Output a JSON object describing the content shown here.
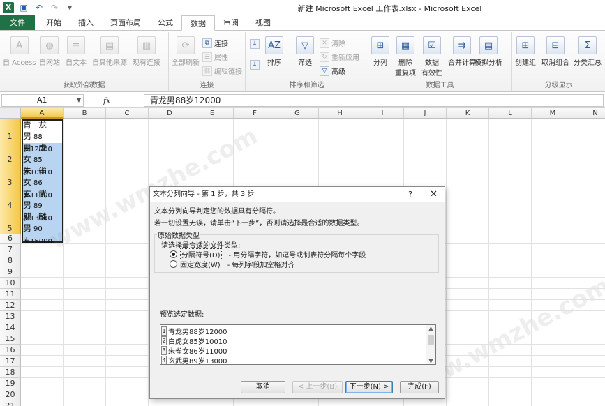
{
  "app": {
    "title": "新建 Microsoft Excel 工作表.xlsx - Microsoft Excel",
    "window_controls": [
      "?",
      "—",
      "❐",
      "✕"
    ]
  },
  "qat": [
    "save-icon",
    "undo-icon",
    "redo-icon",
    "customize-icon"
  ],
  "tabs": [
    {
      "label": "文件",
      "state": "file"
    },
    {
      "label": "开始"
    },
    {
      "label": "插入"
    },
    {
      "label": "页面布局"
    },
    {
      "label": "公式"
    },
    {
      "label": "数据",
      "state": "active"
    },
    {
      "label": "审阅"
    },
    {
      "label": "视图"
    }
  ],
  "ribbon": {
    "groups": {
      "external": {
        "label": "获取外部数据",
        "buttons": [
          "自 Access",
          "自网站",
          "自文本",
          "自其他来源",
          "现有连接"
        ]
      },
      "connections": {
        "label": "连接",
        "refresh": "全部刷新",
        "small": [
          "连接",
          "属性",
          "编辑链接"
        ]
      },
      "sort_filter": {
        "label": "排序和筛选",
        "sort": "排序",
        "filter": "筛选",
        "small": [
          "清除",
          "重新应用",
          "高级"
        ]
      },
      "data_tools": {
        "label": "数据工具",
        "buttons": [
          "分列",
          "删除",
          "数据",
          "合并计算",
          "模拟分析"
        ],
        "second_line": [
          "重复项",
          "有效性"
        ]
      },
      "outline": {
        "label": "分级显示",
        "buttons": [
          "创建组",
          "取消组合",
          "分类汇总"
        ]
      }
    }
  },
  "formula_bar": {
    "name_box": "A1",
    "fx": "fx",
    "content": "青龙男88岁12000"
  },
  "columns": [
    "A",
    "B",
    "C",
    "D",
    "E",
    "F",
    "G",
    "H",
    "I",
    "J",
    "K",
    "L",
    "M",
    "N"
  ],
  "rows": [
    "1",
    "2",
    "3",
    "4",
    "5",
    "6",
    "7",
    "8",
    "9",
    "10",
    "11",
    "12",
    "13",
    "14",
    "15",
    "16",
    "17",
    "18",
    "19",
    "20",
    "21"
  ],
  "cells": [
    {
      "big": "青 龙 男",
      "num": "88",
      "line2": "岁12000"
    },
    {
      "big": "白 虎 女",
      "num": "85",
      "line2": "岁10010"
    },
    {
      "big": "朱 雀 女",
      "num": "86",
      "line2": "岁11000"
    },
    {
      "big": "玄 武 男",
      "num": "89",
      "line2": "岁13000"
    },
    {
      "big": "麒 麟 男",
      "num": "90",
      "line2": "岁15000"
    }
  ],
  "dialog": {
    "title": "文本分列向导 - 第 1 步，共 3 步",
    "help": "?",
    "close": "✕",
    "intro1": "文本分列向导判定您的数据具有分隔符。",
    "intro2": "若一切设置无误，请单击“下一步”，否则请选择最合适的数据类型。",
    "group_label": "原始数据类型",
    "choose_label": "请选择最合适的文件类型:",
    "options": [
      {
        "label": "分隔符号(D)",
        "desc": "- 用分隔字符，如逗号或制表符分隔每个字段",
        "checked": true
      },
      {
        "label": "固定宽度(W)",
        "desc": "- 每列字段加空格对齐",
        "checked": false
      }
    ],
    "preview_label": "预览选定数据:",
    "preview_rows": [
      {
        "num": "1",
        "text": "青龙男88岁12000"
      },
      {
        "num": "2",
        "text": "白虎女85岁10010"
      },
      {
        "num": "3",
        "text": "朱雀女86岁11000"
      },
      {
        "num": "4",
        "text": "玄武男89岁13000"
      }
    ],
    "buttons": {
      "cancel": "取消",
      "back": "< 上一步(B)",
      "next": "下一步(N) >",
      "finish": "完成(F)"
    }
  },
  "watermark": "www.wmzhe.com"
}
